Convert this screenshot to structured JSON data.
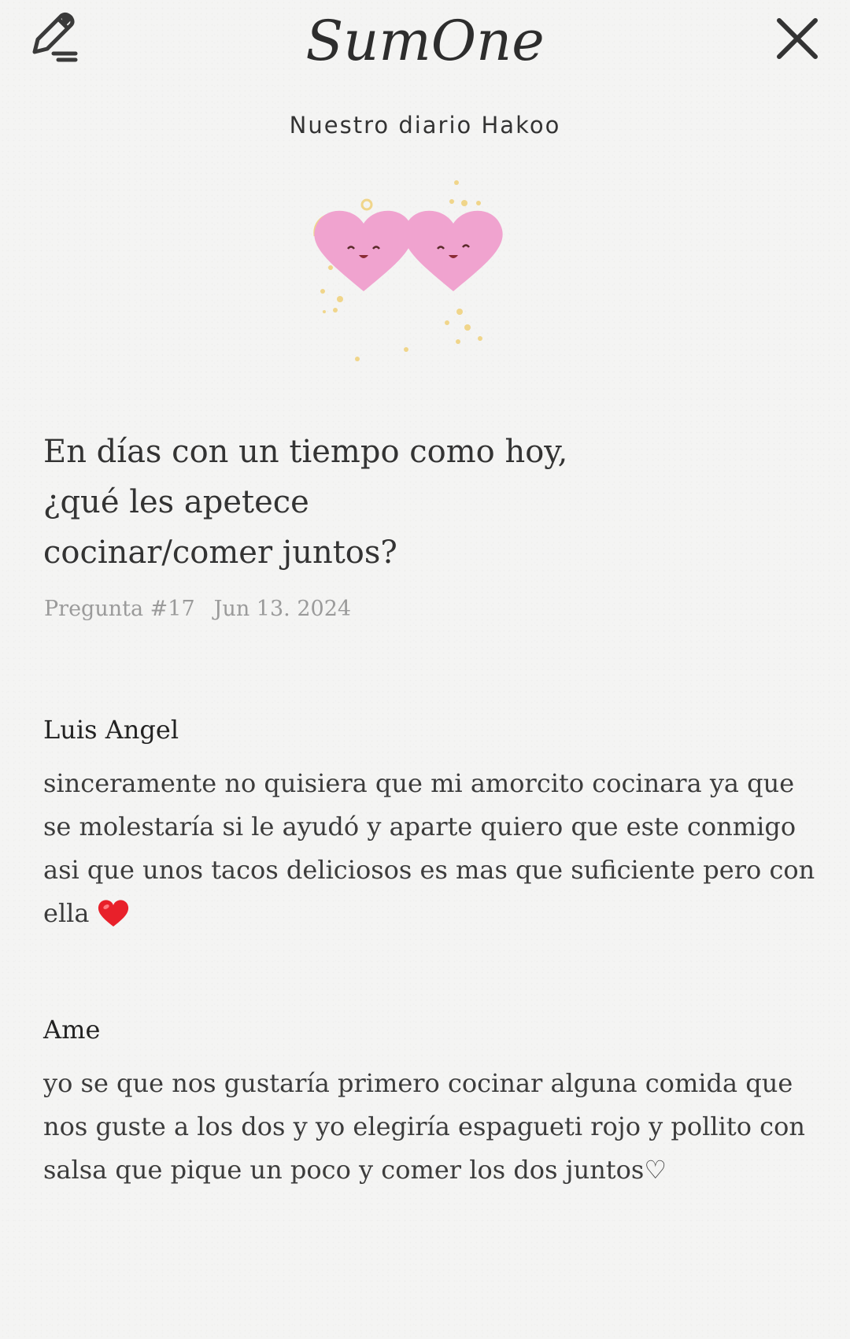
{
  "header": {
    "app_name": "SumOne",
    "edit_icon": "pencil-edit-icon",
    "close_icon": "close-icon"
  },
  "diary_title": "Nuestro diario Hakoo",
  "illustration": {
    "name": "two-smiling-hearts",
    "color": "#f0a3cf"
  },
  "question": {
    "lines": [
      "En días con un tiempo como hoy,",
      "¿qué les apetece",
      "cocinar/comer juntos?"
    ],
    "number_label": "Pregunta #17",
    "date": "Jun 13. 2024"
  },
  "answers": [
    {
      "name": "Luis Angel",
      "lines": [
        "sinceramente no quisiera que mi amorcito cocinara ya que",
        "se molestaría si le ayudó y aparte quiero que este conmigo",
        "asi que unos tacos deliciosos es mas que suficiente pero con",
        "ella"
      ],
      "emoji": "red-heart-emoji",
      "emoji_color": "#e8202a"
    },
    {
      "name": "Ame",
      "lines": [
        "yo se que nos gustaría primero cocinar alguna comida que",
        "nos guste a los dos y yo elegiría espagueti rojo y pollito con",
        "salsa que pique un poco y comer los dos juntos♡"
      ]
    }
  ]
}
